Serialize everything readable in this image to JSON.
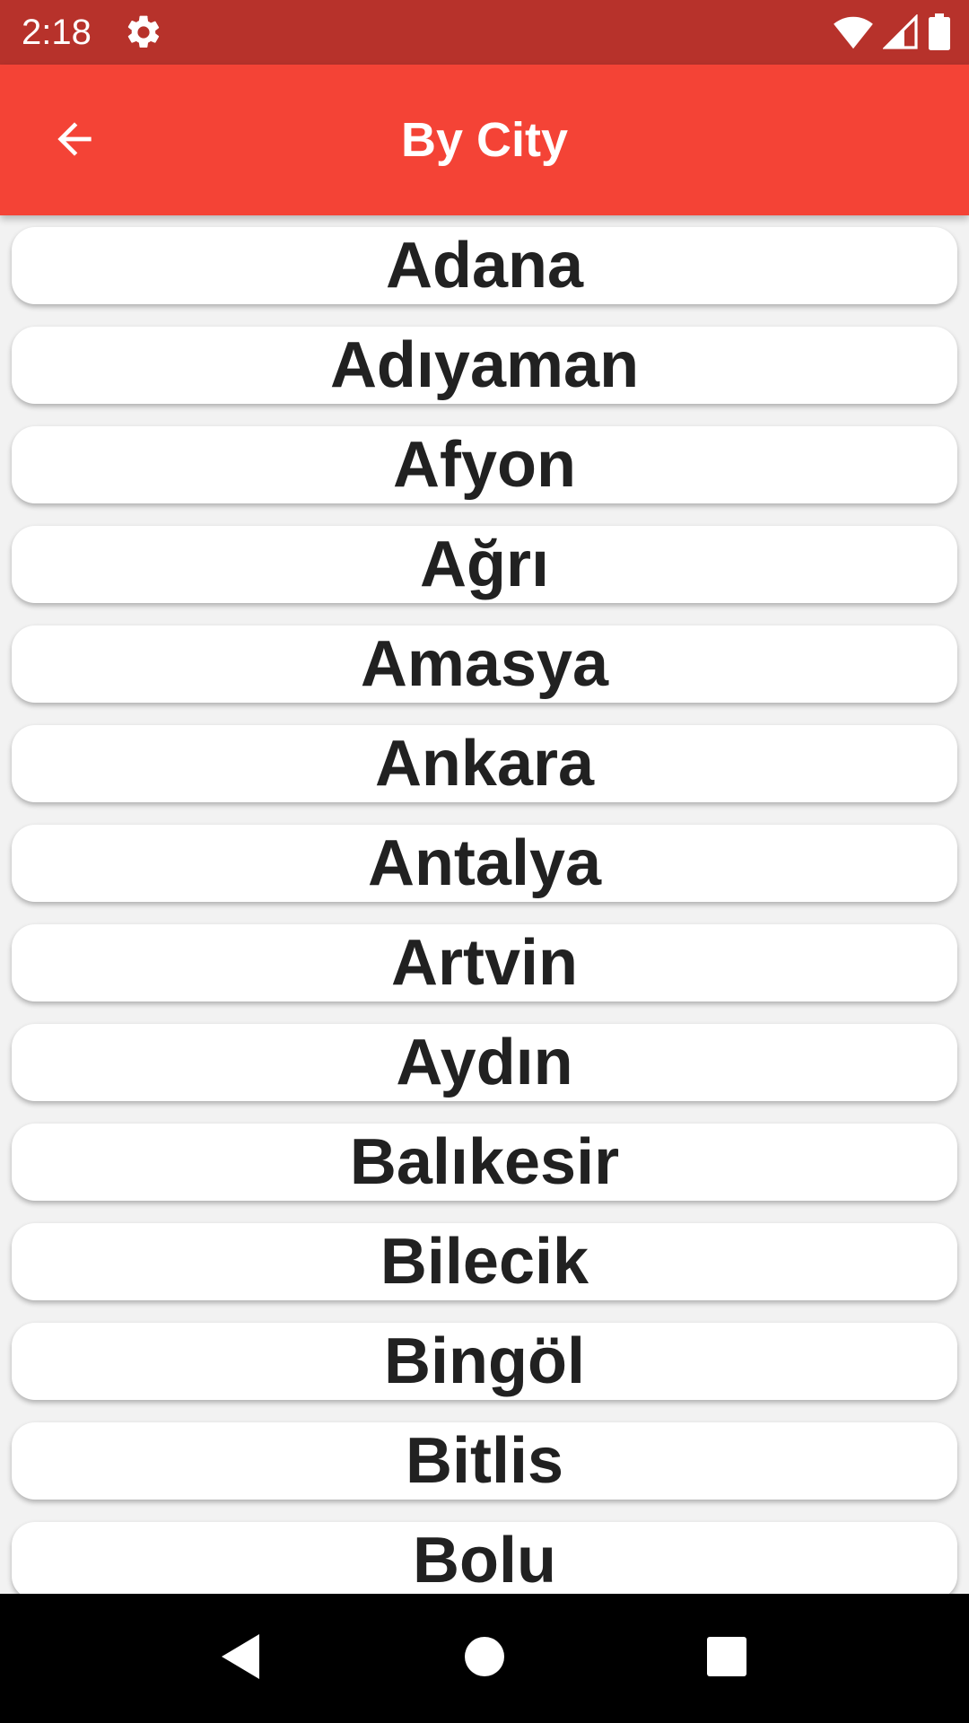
{
  "status_bar": {
    "time": "2:18",
    "icons": [
      "gear-icon",
      "wifi-icon",
      "signal-icon",
      "battery-icon"
    ]
  },
  "app_bar": {
    "title": "By City",
    "back_icon": "arrow-back-icon",
    "color": "#f44336"
  },
  "cities": [
    "Adana",
    "Adıyaman",
    "Afyon",
    "Ağrı",
    "Amasya",
    "Ankara",
    "Antalya",
    "Artvin",
    "Aydın",
    "Balıkesir",
    "Bilecik",
    "Bingöl",
    "Bitlis",
    "Bolu"
  ],
  "nav_bar": {
    "icons": [
      "back-triangle-icon",
      "home-circle-icon",
      "recents-square-icon"
    ]
  }
}
